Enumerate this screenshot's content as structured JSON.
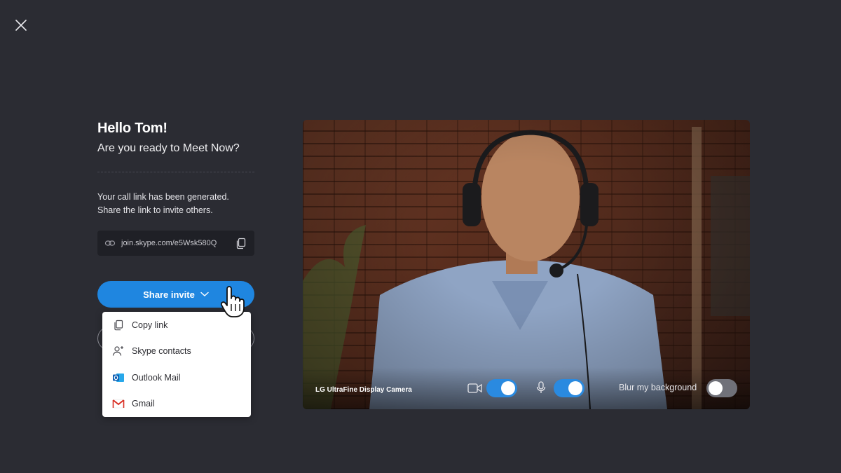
{
  "greeting": "Hello  Tom!",
  "subtitle": "Are you ready to Meet Now?",
  "info_text": "Your call link has been generated. Share the link to invite others.",
  "call_link": "join.skype.com/e5Wsk580Q",
  "share_button": {
    "label": "Share invite"
  },
  "share_menu": [
    {
      "label": "Copy link",
      "icon": "copy-icon"
    },
    {
      "label": "Skype contacts",
      "icon": "add-contact-icon"
    },
    {
      "label": "Outlook Mail",
      "icon": "outlook-icon"
    },
    {
      "label": "Gmail",
      "icon": "gmail-icon"
    }
  ],
  "video": {
    "camera_label": "LG UltraFine Display Camera",
    "camera_on": true,
    "mic_on": true,
    "blur_label": "Blur my background",
    "blur_on": false
  },
  "colors": {
    "background": "#2b2c33",
    "accent": "#1f86e0",
    "toggle_on": "#2a8ae0",
    "toggle_off": "#707179"
  }
}
